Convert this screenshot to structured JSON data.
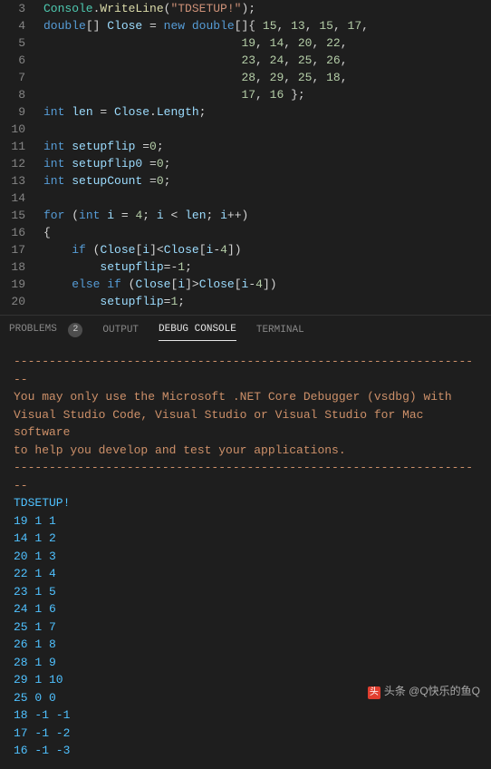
{
  "editor": {
    "startLine": 3,
    "lines": [
      {
        "n": 3,
        "tokens": [
          {
            "t": "Console",
            "c": "cls"
          },
          {
            "t": ".",
            "c": "punc"
          },
          {
            "t": "WriteLine",
            "c": "fn"
          },
          {
            "t": "(",
            "c": "punc"
          },
          {
            "t": "\"TDSETUP!\"",
            "c": "str"
          },
          {
            "t": ");",
            "c": "punc"
          }
        ]
      },
      {
        "n": 4,
        "tokens": [
          {
            "t": "double",
            "c": "kw"
          },
          {
            "t": "[] ",
            "c": "punc"
          },
          {
            "t": "Close",
            "c": "var"
          },
          {
            "t": " = ",
            "c": "op"
          },
          {
            "t": "new",
            "c": "kw"
          },
          {
            "t": " ",
            "c": "punc"
          },
          {
            "t": "double",
            "c": "kw"
          },
          {
            "t": "[]{ ",
            "c": "punc"
          },
          {
            "t": "15",
            "c": "num"
          },
          {
            "t": ", ",
            "c": "punc"
          },
          {
            "t": "13",
            "c": "num"
          },
          {
            "t": ", ",
            "c": "punc"
          },
          {
            "t": "15",
            "c": "num"
          },
          {
            "t": ", ",
            "c": "punc"
          },
          {
            "t": "17",
            "c": "num"
          },
          {
            "t": ",",
            "c": "punc"
          }
        ]
      },
      {
        "n": 5,
        "indent": "                            ",
        "tokens": [
          {
            "t": "19",
            "c": "num"
          },
          {
            "t": ", ",
            "c": "punc"
          },
          {
            "t": "14",
            "c": "num"
          },
          {
            "t": ", ",
            "c": "punc"
          },
          {
            "t": "20",
            "c": "num"
          },
          {
            "t": ", ",
            "c": "punc"
          },
          {
            "t": "22",
            "c": "num"
          },
          {
            "t": ",",
            "c": "punc"
          }
        ]
      },
      {
        "n": 6,
        "indent": "                            ",
        "tokens": [
          {
            "t": "23",
            "c": "num"
          },
          {
            "t": ", ",
            "c": "punc"
          },
          {
            "t": "24",
            "c": "num"
          },
          {
            "t": ", ",
            "c": "punc"
          },
          {
            "t": "25",
            "c": "num"
          },
          {
            "t": ", ",
            "c": "punc"
          },
          {
            "t": "26",
            "c": "num"
          },
          {
            "t": ",",
            "c": "punc"
          }
        ]
      },
      {
        "n": 7,
        "indent": "                            ",
        "tokens": [
          {
            "t": "28",
            "c": "num"
          },
          {
            "t": ", ",
            "c": "punc"
          },
          {
            "t": "29",
            "c": "num"
          },
          {
            "t": ", ",
            "c": "punc"
          },
          {
            "t": "25",
            "c": "num"
          },
          {
            "t": ", ",
            "c": "punc"
          },
          {
            "t": "18",
            "c": "num"
          },
          {
            "t": ",",
            "c": "punc"
          }
        ]
      },
      {
        "n": 8,
        "indent": "                            ",
        "tokens": [
          {
            "t": "17",
            "c": "num"
          },
          {
            "t": ", ",
            "c": "punc"
          },
          {
            "t": "16",
            "c": "num"
          },
          {
            "t": " };",
            "c": "punc"
          }
        ]
      },
      {
        "n": 9,
        "tokens": [
          {
            "t": "int",
            "c": "kw"
          },
          {
            "t": " ",
            "c": "punc"
          },
          {
            "t": "len",
            "c": "var"
          },
          {
            "t": " = ",
            "c": "op"
          },
          {
            "t": "Close",
            "c": "var"
          },
          {
            "t": ".",
            "c": "punc"
          },
          {
            "t": "Length",
            "c": "var"
          },
          {
            "t": ";",
            "c": "punc"
          }
        ]
      },
      {
        "n": 10,
        "tokens": []
      },
      {
        "n": 11,
        "tokens": [
          {
            "t": "int",
            "c": "kw"
          },
          {
            "t": " ",
            "c": "punc"
          },
          {
            "t": "setupflip",
            "c": "var"
          },
          {
            "t": " =",
            "c": "op"
          },
          {
            "t": "0",
            "c": "num"
          },
          {
            "t": ";",
            "c": "punc"
          }
        ]
      },
      {
        "n": 12,
        "tokens": [
          {
            "t": "int",
            "c": "kw"
          },
          {
            "t": " ",
            "c": "punc"
          },
          {
            "t": "setupflip0",
            "c": "var"
          },
          {
            "t": " =",
            "c": "op"
          },
          {
            "t": "0",
            "c": "num"
          },
          {
            "t": ";",
            "c": "punc"
          }
        ]
      },
      {
        "n": 13,
        "tokens": [
          {
            "t": "int",
            "c": "kw"
          },
          {
            "t": " ",
            "c": "punc"
          },
          {
            "t": "setupCount",
            "c": "var"
          },
          {
            "t": " =",
            "c": "op"
          },
          {
            "t": "0",
            "c": "num"
          },
          {
            "t": ";",
            "c": "punc"
          }
        ]
      },
      {
        "n": 14,
        "tokens": []
      },
      {
        "n": 15,
        "tokens": [
          {
            "t": "for",
            "c": "kw"
          },
          {
            "t": " (",
            "c": "punc"
          },
          {
            "t": "int",
            "c": "kw"
          },
          {
            "t": " ",
            "c": "punc"
          },
          {
            "t": "i",
            "c": "var"
          },
          {
            "t": " = ",
            "c": "op"
          },
          {
            "t": "4",
            "c": "num"
          },
          {
            "t": "; ",
            "c": "punc"
          },
          {
            "t": "i",
            "c": "var"
          },
          {
            "t": " < ",
            "c": "op"
          },
          {
            "t": "len",
            "c": "var"
          },
          {
            "t": "; ",
            "c": "punc"
          },
          {
            "t": "i",
            "c": "var"
          },
          {
            "t": "++)",
            "c": "punc"
          }
        ]
      },
      {
        "n": 16,
        "tokens": [
          {
            "t": "{",
            "c": "punc"
          }
        ]
      },
      {
        "n": 17,
        "indent": "    ",
        "tokens": [
          {
            "t": "if",
            "c": "kw"
          },
          {
            "t": " (",
            "c": "punc"
          },
          {
            "t": "Close",
            "c": "var"
          },
          {
            "t": "[",
            "c": "punc"
          },
          {
            "t": "i",
            "c": "var"
          },
          {
            "t": "]<",
            "c": "punc"
          },
          {
            "t": "Close",
            "c": "var"
          },
          {
            "t": "[",
            "c": "punc"
          },
          {
            "t": "i",
            "c": "var"
          },
          {
            "t": "-",
            "c": "op"
          },
          {
            "t": "4",
            "c": "num"
          },
          {
            "t": "])",
            "c": "punc"
          }
        ]
      },
      {
        "n": 18,
        "indent": "        ",
        "tokens": [
          {
            "t": "setupflip",
            "c": "var"
          },
          {
            "t": "=-",
            "c": "op"
          },
          {
            "t": "1",
            "c": "num"
          },
          {
            "t": ";",
            "c": "punc"
          }
        ]
      },
      {
        "n": 19,
        "indent": "    ",
        "tokens": [
          {
            "t": "else",
            "c": "kw"
          },
          {
            "t": " ",
            "c": "punc"
          },
          {
            "t": "if",
            "c": "kw"
          },
          {
            "t": " (",
            "c": "punc"
          },
          {
            "t": "Close",
            "c": "var"
          },
          {
            "t": "[",
            "c": "punc"
          },
          {
            "t": "i",
            "c": "var"
          },
          {
            "t": "]>",
            "c": "punc"
          },
          {
            "t": "Close",
            "c": "var"
          },
          {
            "t": "[",
            "c": "punc"
          },
          {
            "t": "i",
            "c": "var"
          },
          {
            "t": "-",
            "c": "op"
          },
          {
            "t": "4",
            "c": "num"
          },
          {
            "t": "])",
            "c": "punc"
          }
        ]
      },
      {
        "n": 20,
        "indent": "        ",
        "tokens": [
          {
            "t": "setupflip",
            "c": "var"
          },
          {
            "t": "=",
            "c": "op"
          },
          {
            "t": "1",
            "c": "num"
          },
          {
            "t": ";",
            "c": "punc"
          }
        ]
      }
    ]
  },
  "tabs": {
    "problems": "PROBLEMS",
    "problemsBadge": "2",
    "output": "OUTPUT",
    "debugConsole": "DEBUG CONSOLE",
    "terminal": "TERMINAL"
  },
  "console": {
    "dash1": "-------------------------------------------------------------------",
    "msg1": "You may only use the Microsoft .NET Core Debugger (vsdbg) with",
    "msg2": "Visual Studio Code, Visual Studio or Visual Studio for Mac software",
    "msg3": "to help you develop and test your applications.",
    "dash2": "-------------------------------------------------------------------",
    "output": [
      "TDSETUP!",
      "19 1 1",
      "14 1 2",
      "20 1 3",
      "22 1 4",
      "23 1 5",
      "24 1 6",
      "25 1 7",
      "26 1 8",
      "28 1 9",
      "29 1 10",
      "25 0 0",
      "18 -1 -1",
      "17 -1 -2",
      "16 -1 -3"
    ]
  },
  "footer": {
    "text": "头条 @Q快乐的鱼Q"
  }
}
